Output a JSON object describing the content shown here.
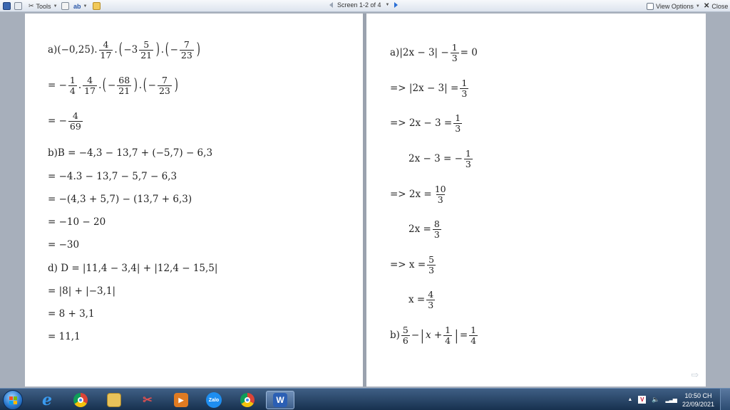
{
  "toolbar": {
    "tools_label": "Tools",
    "screen_label": "Screen 1-2 of 4",
    "view_options_label": "View Options",
    "close_label": "Close"
  },
  "left_page": {
    "l1": {
      "prefix": "a)(−0,25).",
      "f1": [
        "4",
        "17"
      ],
      "mid": "−3",
      "f2": [
        "5",
        "21"
      ],
      "f3": [
        "7",
        "23"
      ]
    },
    "l2": {
      "prefix": "= −",
      "f1": [
        "1",
        "4"
      ],
      "f2": [
        "4",
        "17"
      ],
      "f3": [
        "68",
        "21"
      ],
      "f4": [
        "7",
        "23"
      ]
    },
    "l3": {
      "prefix": "=  −",
      "f1": [
        "4",
        "69"
      ]
    },
    "l4": "b)B = −4,3 − 13,7 + (−5,7) − 6,3",
    "l5": "=  −4.3 − 13,7 − 5,7 − 6,3",
    "l6": "=  −(4,3 + 5,7) − (13,7 + 6,3)",
    "l7": "= −10 − 20",
    "l8": "=  −30",
    "l9": "d) D = |11,4 − 3,4| + |12,4 − 15,5|",
    "l10": "= |8| + |−3,1|",
    "l11": "= 8 + 3,1",
    "l12": "= 11,1"
  },
  "right_page": {
    "r1": {
      "prefix": "a)|2x − 3| −",
      "f1": [
        "1",
        "3"
      ],
      "suffix": "= 0"
    },
    "r2": {
      "prefix": "=> |2x − 3| =",
      "f1": [
        "1",
        "3"
      ]
    },
    "r3": {
      "prefix": "=> 2x − 3 =",
      "f1": [
        "1",
        "3"
      ]
    },
    "r4": {
      "prefix": "2x − 3 = −",
      "f1": [
        "1",
        "3"
      ]
    },
    "r5": {
      "prefix": "=> 2x =",
      "f1": [
        "10",
        "3"
      ]
    },
    "r6": {
      "prefix": "2x =",
      "f1": [
        "8",
        "3"
      ]
    },
    "r7": {
      "prefix": "=> x =",
      "f1": [
        "5",
        "3"
      ]
    },
    "r8": {
      "prefix": "x =",
      "f1": [
        "4",
        "3"
      ]
    },
    "r9": {
      "prefix": "b)",
      "f1": [
        "5",
        "6"
      ],
      "op": "−",
      "x": "x +",
      "f2": [
        "1",
        "4"
      ],
      "eq": "=",
      "f3": [
        "1",
        "4"
      ]
    }
  },
  "taskbar": {
    "apps": [
      {
        "name": "internet-explorer",
        "glyph": "e",
        "color": "#1e78d2"
      },
      {
        "name": "chrome",
        "glyph": "",
        "color": "#dd4b39"
      },
      {
        "name": "file-explorer",
        "glyph": "",
        "color": "#e8c25a"
      },
      {
        "name": "snipping-tool",
        "glyph": "",
        "color": "#d04040"
      },
      {
        "name": "media-player",
        "glyph": "",
        "color": "#e07b22"
      },
      {
        "name": "zalo",
        "glyph": "Zalo",
        "color": "#1e8ef0"
      },
      {
        "name": "chrome-profile",
        "glyph": "",
        "color": "#dd4b39"
      },
      {
        "name": "word",
        "glyph": "W",
        "color": "#2b5fb4"
      }
    ],
    "clock_time": "10:50 CH",
    "clock_date": "22/09/2021"
  }
}
